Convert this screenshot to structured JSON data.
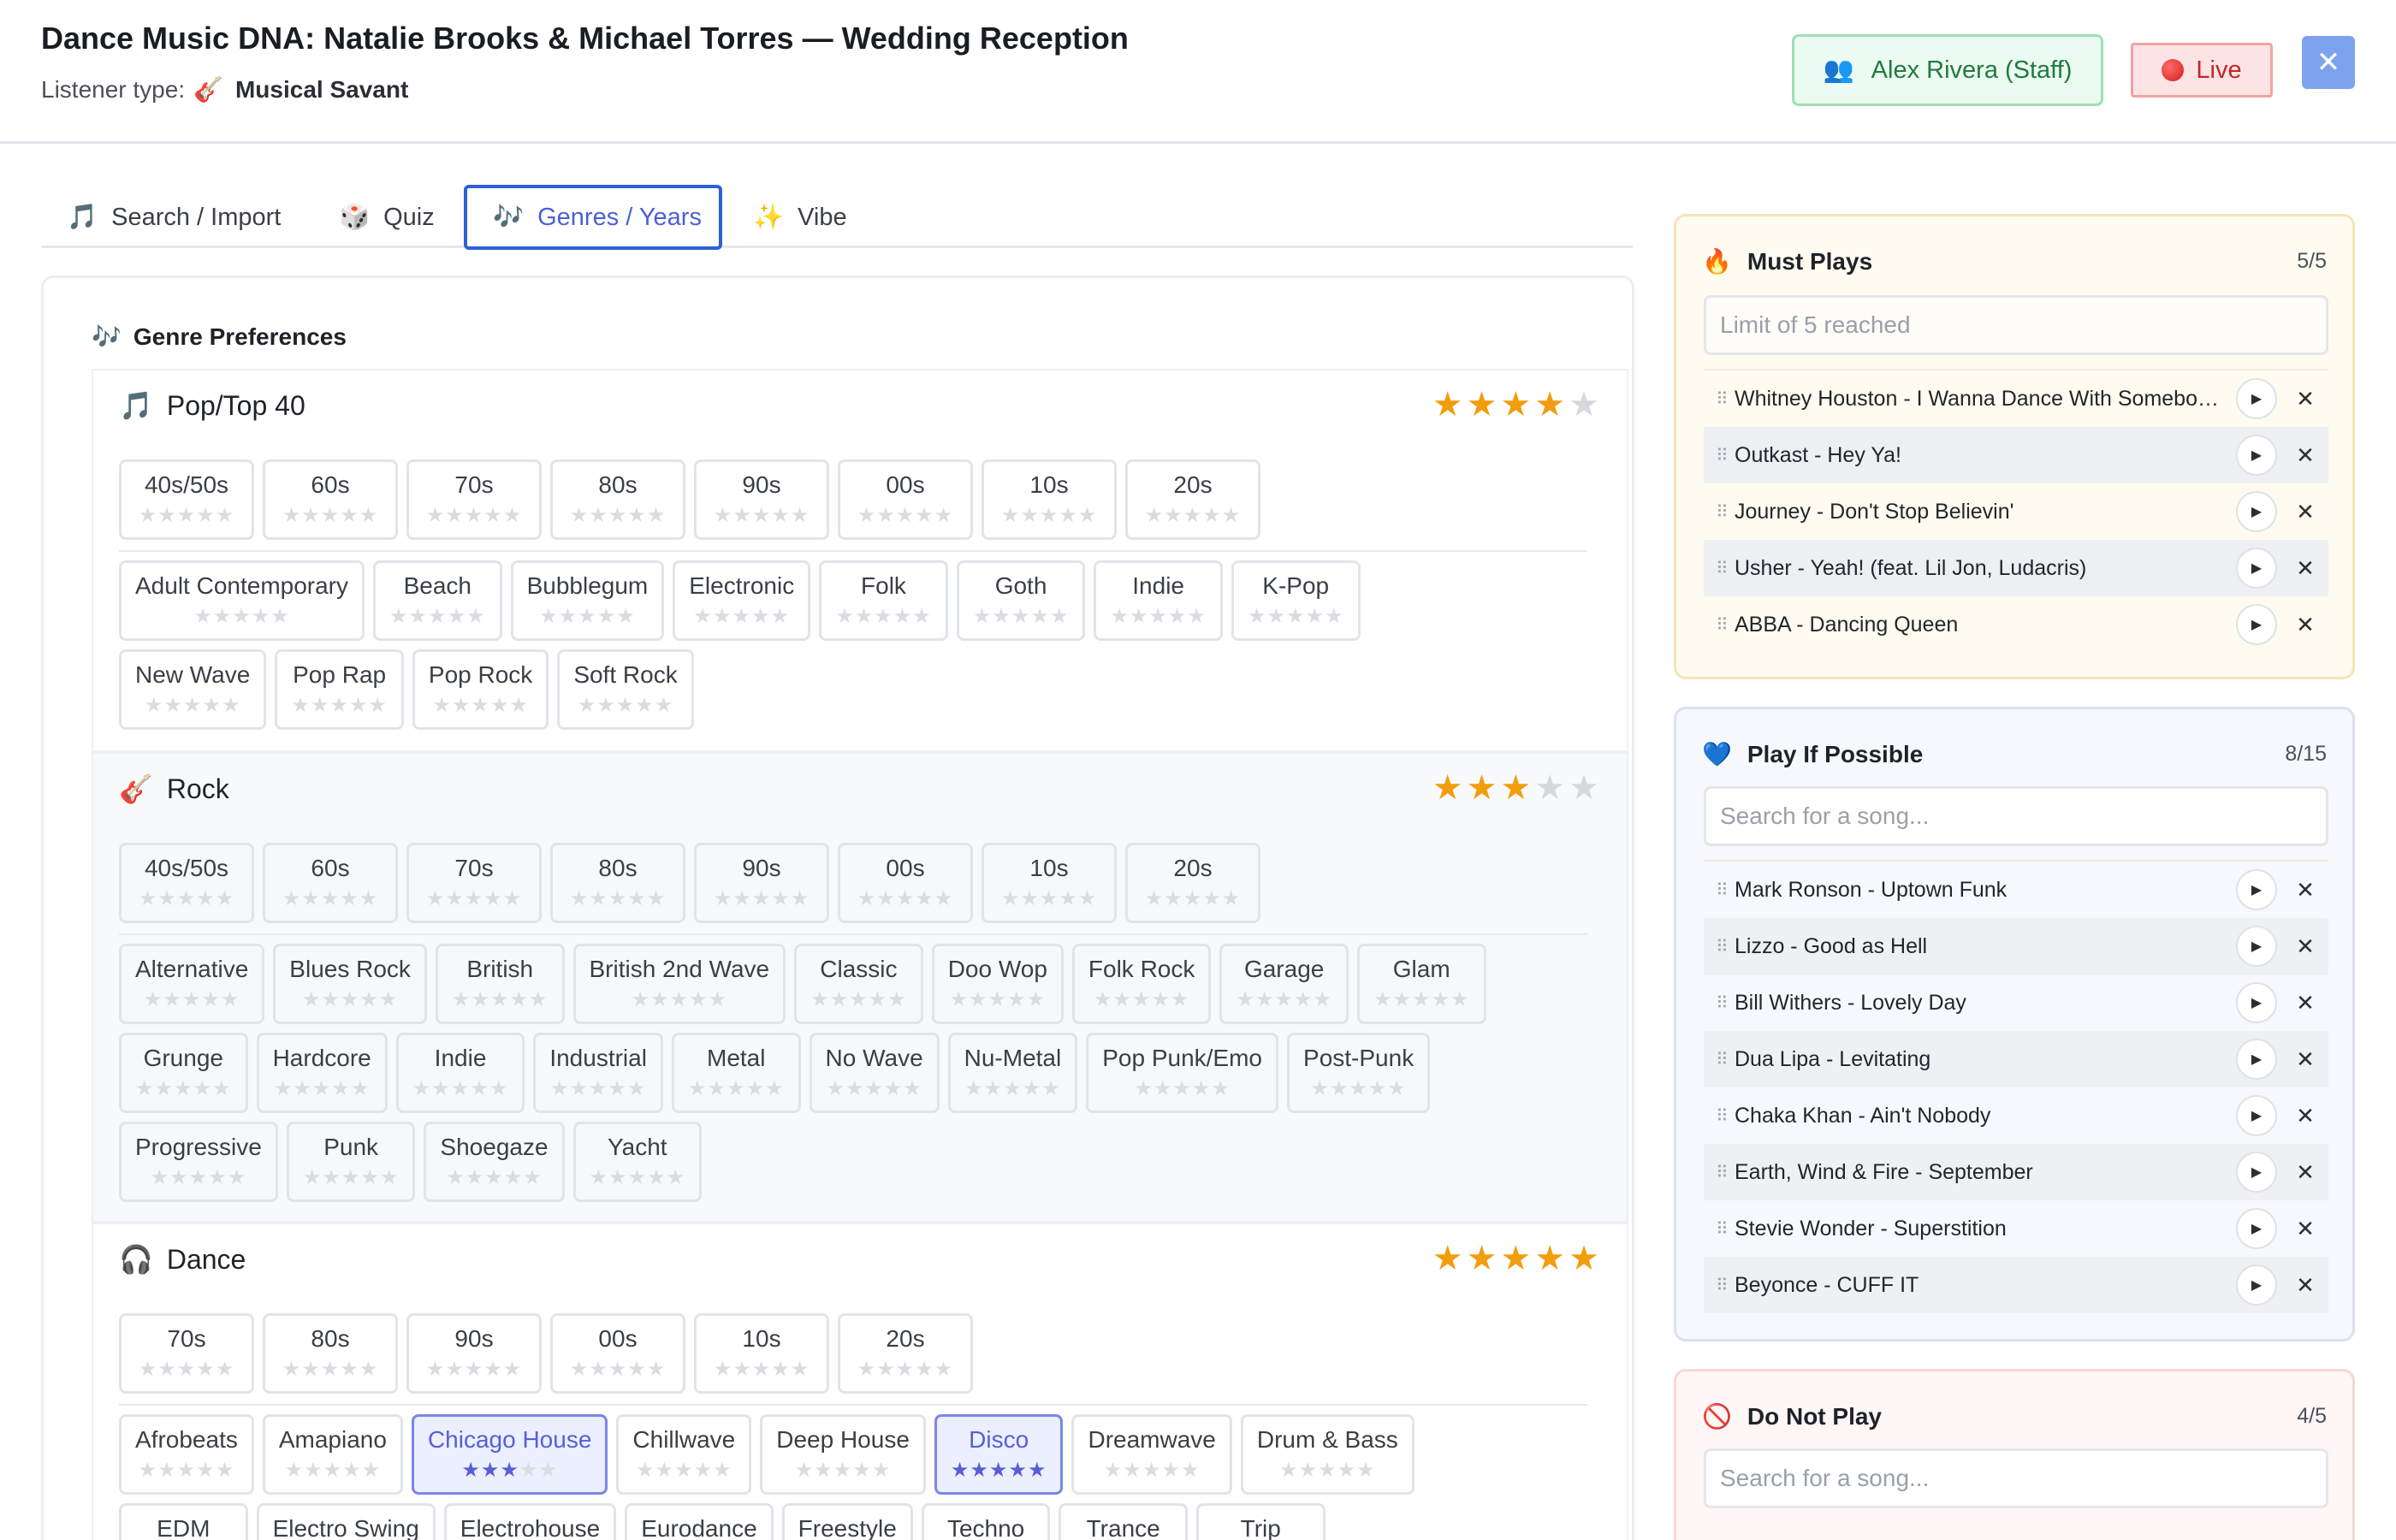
{
  "header": {
    "title": "Dance Music DNA: Natalie Brooks & Michael Torres — Wedding Reception",
    "listener_label": "Listener type:",
    "listener_emoji": "🎸",
    "listener_value": "Musical Savant",
    "staff_icon": "👥",
    "staff_label": "Alex Rivera (Staff)",
    "live_label": "Live",
    "close_icon": "✕"
  },
  "tabs": [
    {
      "icon": "🎵",
      "label": "Search / Import"
    },
    {
      "icon": "🎲",
      "label": "Quiz"
    },
    {
      "icon": "🎶",
      "label": "Genres / Years"
    },
    {
      "icon": "✨",
      "label": "Vibe"
    }
  ],
  "genre_preferences": {
    "icon": "🎶",
    "title": "Genre Preferences",
    "genres": [
      {
        "icon": "🎵",
        "name": "Pop/Top 40",
        "rating": 4,
        "decades": [
          "40s/50s",
          "60s",
          "70s",
          "80s",
          "90s",
          "00s",
          "10s",
          "20s"
        ],
        "styles": [
          [
            "Adult Contemporary",
            "Beach",
            "Bubblegum",
            "Electronic",
            "Folk",
            "Goth",
            "Indie",
            "K-Pop"
          ],
          [
            "New Wave",
            "Pop Rap",
            "Pop Rock",
            "Soft Rock"
          ]
        ]
      },
      {
        "icon": "🎸",
        "name": "Rock",
        "rating": 3,
        "decades": [
          "40s/50s",
          "60s",
          "70s",
          "80s",
          "90s",
          "00s",
          "10s",
          "20s"
        ],
        "styles": [
          [
            "Alternative",
            "Blues Rock",
            "British",
            "British 2nd Wave",
            "Classic",
            "Doo Wop",
            "Folk Rock",
            "Garage",
            "Glam"
          ],
          [
            "Grunge",
            "Hardcore",
            "Indie",
            "Industrial",
            "Metal",
            "No Wave",
            "Nu-Metal",
            "Pop Punk/Emo",
            "Post-Punk"
          ],
          [
            "Progressive",
            "Punk",
            "Shoegaze",
            "Yacht"
          ]
        ]
      },
      {
        "icon": "🎧",
        "name": "Dance",
        "rating": 5,
        "decades": [
          "70s",
          "80s",
          "90s",
          "00s",
          "10s",
          "20s"
        ],
        "styles": [
          [
            "Afrobeats",
            "Amapiano",
            "Chicago House",
            "Chillwave",
            "Deep House",
            "Disco",
            "Dreamwave",
            "Drum & Bass"
          ],
          [
            "EDM",
            "Electro Swing",
            "Electrohouse",
            "Eurodance",
            "Freestyle",
            "Techno",
            "Trance",
            "Trip"
          ]
        ],
        "style_ratings": {
          "Chicago House": 3,
          "Disco": 5
        }
      }
    ]
  },
  "must_plays": {
    "icon": "🔥",
    "title": "Must Plays",
    "count": "5/5",
    "placeholder": "Limit of 5 reached",
    "songs": [
      "Whitney Houston - I Wanna Dance With Somebody (Who Loves Me)",
      "Outkast - Hey Ya!",
      "Journey - Don't Stop Believin'",
      "Usher - Yeah! (feat. Lil Jon, Ludacris)",
      "ABBA - Dancing Queen"
    ]
  },
  "play_if_possible": {
    "icon": "💙",
    "title": "Play If Possible",
    "count": "8/15",
    "placeholder": "Search for a song...",
    "songs": [
      "Mark Ronson - Uptown Funk",
      "Lizzo - Good as Hell",
      "Bill Withers - Lovely Day",
      "Dua Lipa - Levitating",
      "Chaka Khan - Ain't Nobody",
      "Earth, Wind & Fire - September",
      "Stevie Wonder - Superstition",
      "Beyonce - CUFF IT"
    ]
  },
  "do_not_play": {
    "icon": "🚫",
    "title": "Do Not Play",
    "count": "4/5",
    "placeholder": "Search for a song..."
  },
  "glyphs": {
    "star": "★",
    "grip": "⠿",
    "play": "▶",
    "remove": "✕"
  },
  "colors": {
    "accent": "#4c5fd5",
    "star": "#f29d0d",
    "live": "#c22727",
    "staff": "#1f7a3e"
  }
}
